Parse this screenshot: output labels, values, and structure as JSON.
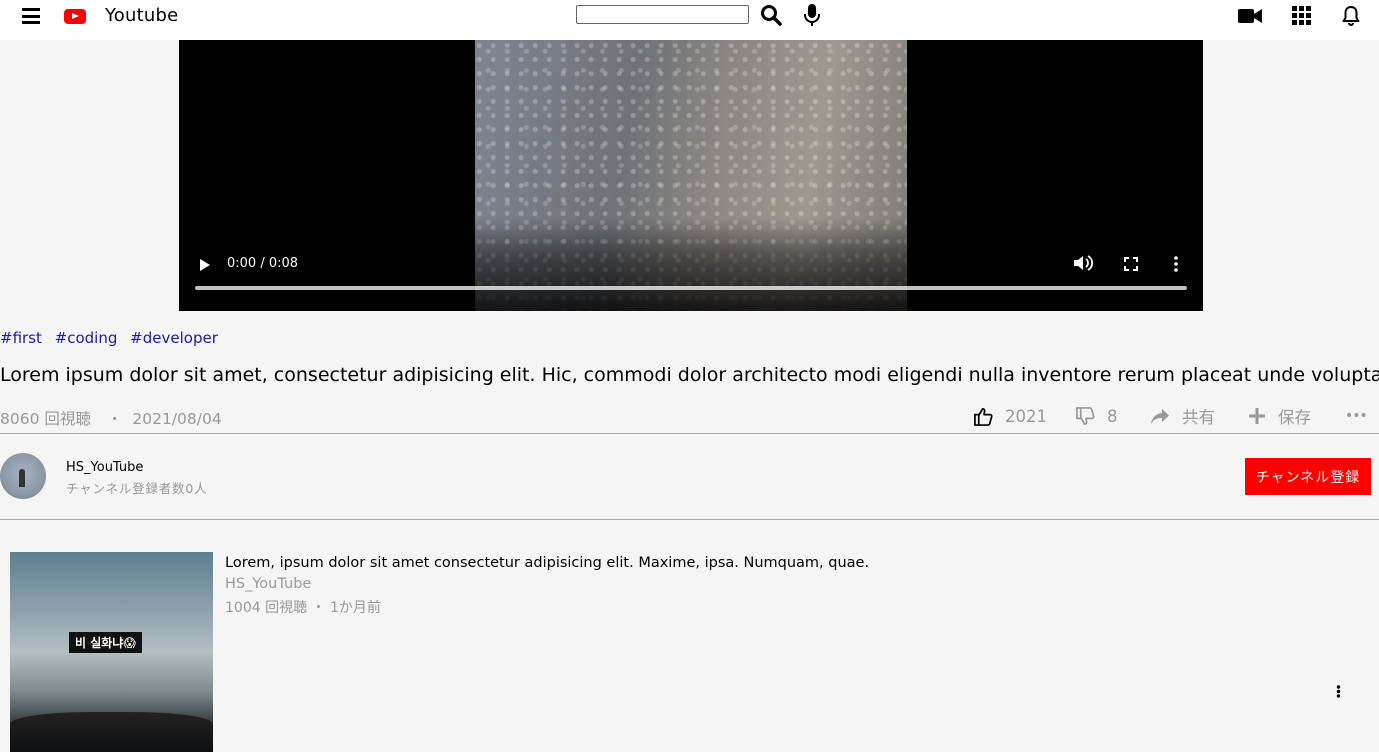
{
  "header": {
    "logo_text": "Youtube",
    "search_placeholder": "",
    "icons": [
      "menu-icon",
      "youtube-logo-icon",
      "search-icon",
      "mic-icon",
      "video-camera-icon",
      "apps-grid-icon",
      "bell-icon"
    ]
  },
  "player": {
    "time": "0:00 / 0:08",
    "progress": 0
  },
  "video": {
    "tags": [
      "#first",
      "#coding",
      "#developer"
    ],
    "title": "Lorem ipsum dolor sit amet, consectetur adipisicing elit. Hic, commodi dolor architecto modi eligendi nulla inventore rerum placeat unde voluptatum?",
    "views": "8060 回視聴",
    "separator": "・",
    "date": "2021/08/04",
    "likes": "2021",
    "dislikes": "8",
    "share_label": "共有",
    "save_label": "保存",
    "more_label": "•••"
  },
  "channel": {
    "name": "HS_YouTube",
    "subscribers": "チャンネル登録者数0人",
    "subscribe_label": "チャンネル登録"
  },
  "recommended": [
    {
      "title": "Lorem, ipsum dolor sit amet consectetur adipisicing elit. Maxime, ipsa. Numquam, quae.",
      "channel": "HS_YouTube",
      "meta": "1004 回視聴 ・ 1か月前",
      "thumb_caption": "비 실화냐😱"
    }
  ],
  "colors": {
    "accent": "#ff0000",
    "tag_link": "#1a1aa6",
    "muted_text": "#999999",
    "background": "#f5f5f5"
  }
}
